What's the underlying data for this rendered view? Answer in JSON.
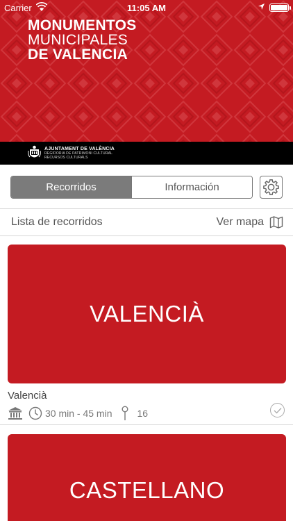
{
  "status_bar": {
    "carrier": "Carrier",
    "time": "11:05 AM",
    "battery_level": 1.0
  },
  "header": {
    "title_line1": "MONUMENTOS",
    "title_line2": "MUNICIPALES",
    "title_line3": "DE VALENCIA",
    "org_name": "AJUNTAMENT DE VALÈNCIA",
    "org_sub1": "REGIDORIA DE PATRIMONI CULTURAL",
    "org_sub2": "RECURSOS CULTURALS",
    "brand_color": "#c41b22"
  },
  "tabs": [
    {
      "label": "Recorridos",
      "active": true
    },
    {
      "label": "Información",
      "active": false
    }
  ],
  "settings_icon": "gear-icon",
  "list": {
    "title": "Lista de recorridos",
    "map_link": "Ver mapa",
    "routes": [
      {
        "card_label": "VALENCIÀ",
        "name": "Valencià",
        "duration": "30 min - 45 min",
        "stops": "16"
      },
      {
        "card_label": "CASTELLANO"
      }
    ]
  }
}
